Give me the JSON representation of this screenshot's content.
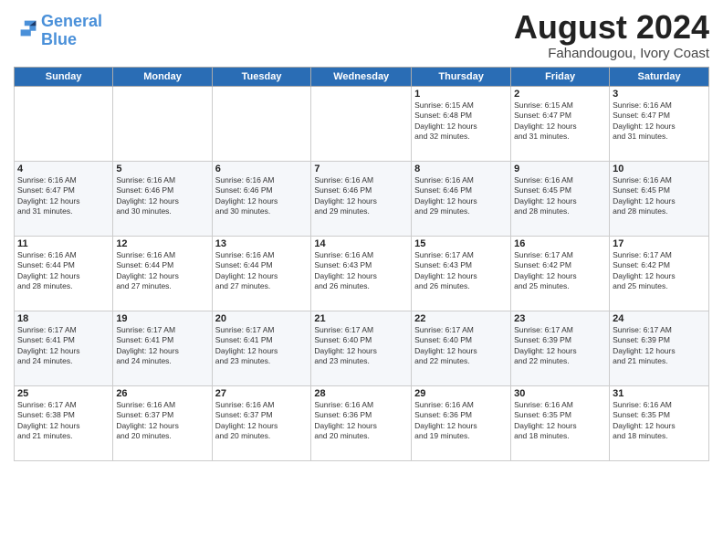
{
  "header": {
    "logo_line1": "General",
    "logo_line2": "Blue",
    "title": "August 2024",
    "subtitle": "Fahandougou, Ivory Coast"
  },
  "calendar": {
    "weekdays": [
      "Sunday",
      "Monday",
      "Tuesday",
      "Wednesday",
      "Thursday",
      "Friday",
      "Saturday"
    ],
    "weeks": [
      [
        {
          "day": "",
          "info": ""
        },
        {
          "day": "",
          "info": ""
        },
        {
          "day": "",
          "info": ""
        },
        {
          "day": "",
          "info": ""
        },
        {
          "day": "1",
          "info": "Sunrise: 6:15 AM\nSunset: 6:48 PM\nDaylight: 12 hours\nand 32 minutes."
        },
        {
          "day": "2",
          "info": "Sunrise: 6:15 AM\nSunset: 6:47 PM\nDaylight: 12 hours\nand 31 minutes."
        },
        {
          "day": "3",
          "info": "Sunrise: 6:16 AM\nSunset: 6:47 PM\nDaylight: 12 hours\nand 31 minutes."
        }
      ],
      [
        {
          "day": "4",
          "info": "Sunrise: 6:16 AM\nSunset: 6:47 PM\nDaylight: 12 hours\nand 31 minutes."
        },
        {
          "day": "5",
          "info": "Sunrise: 6:16 AM\nSunset: 6:46 PM\nDaylight: 12 hours\nand 30 minutes."
        },
        {
          "day": "6",
          "info": "Sunrise: 6:16 AM\nSunset: 6:46 PM\nDaylight: 12 hours\nand 30 minutes."
        },
        {
          "day": "7",
          "info": "Sunrise: 6:16 AM\nSunset: 6:46 PM\nDaylight: 12 hours\nand 29 minutes."
        },
        {
          "day": "8",
          "info": "Sunrise: 6:16 AM\nSunset: 6:46 PM\nDaylight: 12 hours\nand 29 minutes."
        },
        {
          "day": "9",
          "info": "Sunrise: 6:16 AM\nSunset: 6:45 PM\nDaylight: 12 hours\nand 28 minutes."
        },
        {
          "day": "10",
          "info": "Sunrise: 6:16 AM\nSunset: 6:45 PM\nDaylight: 12 hours\nand 28 minutes."
        }
      ],
      [
        {
          "day": "11",
          "info": "Sunrise: 6:16 AM\nSunset: 6:44 PM\nDaylight: 12 hours\nand 28 minutes."
        },
        {
          "day": "12",
          "info": "Sunrise: 6:16 AM\nSunset: 6:44 PM\nDaylight: 12 hours\nand 27 minutes."
        },
        {
          "day": "13",
          "info": "Sunrise: 6:16 AM\nSunset: 6:44 PM\nDaylight: 12 hours\nand 27 minutes."
        },
        {
          "day": "14",
          "info": "Sunrise: 6:16 AM\nSunset: 6:43 PM\nDaylight: 12 hours\nand 26 minutes."
        },
        {
          "day": "15",
          "info": "Sunrise: 6:17 AM\nSunset: 6:43 PM\nDaylight: 12 hours\nand 26 minutes."
        },
        {
          "day": "16",
          "info": "Sunrise: 6:17 AM\nSunset: 6:42 PM\nDaylight: 12 hours\nand 25 minutes."
        },
        {
          "day": "17",
          "info": "Sunrise: 6:17 AM\nSunset: 6:42 PM\nDaylight: 12 hours\nand 25 minutes."
        }
      ],
      [
        {
          "day": "18",
          "info": "Sunrise: 6:17 AM\nSunset: 6:41 PM\nDaylight: 12 hours\nand 24 minutes."
        },
        {
          "day": "19",
          "info": "Sunrise: 6:17 AM\nSunset: 6:41 PM\nDaylight: 12 hours\nand 24 minutes."
        },
        {
          "day": "20",
          "info": "Sunrise: 6:17 AM\nSunset: 6:41 PM\nDaylight: 12 hours\nand 23 minutes."
        },
        {
          "day": "21",
          "info": "Sunrise: 6:17 AM\nSunset: 6:40 PM\nDaylight: 12 hours\nand 23 minutes."
        },
        {
          "day": "22",
          "info": "Sunrise: 6:17 AM\nSunset: 6:40 PM\nDaylight: 12 hours\nand 22 minutes."
        },
        {
          "day": "23",
          "info": "Sunrise: 6:17 AM\nSunset: 6:39 PM\nDaylight: 12 hours\nand 22 minutes."
        },
        {
          "day": "24",
          "info": "Sunrise: 6:17 AM\nSunset: 6:39 PM\nDaylight: 12 hours\nand 21 minutes."
        }
      ],
      [
        {
          "day": "25",
          "info": "Sunrise: 6:17 AM\nSunset: 6:38 PM\nDaylight: 12 hours\nand 21 minutes."
        },
        {
          "day": "26",
          "info": "Sunrise: 6:16 AM\nSunset: 6:37 PM\nDaylight: 12 hours\nand 20 minutes."
        },
        {
          "day": "27",
          "info": "Sunrise: 6:16 AM\nSunset: 6:37 PM\nDaylight: 12 hours\nand 20 minutes."
        },
        {
          "day": "28",
          "info": "Sunrise: 6:16 AM\nSunset: 6:36 PM\nDaylight: 12 hours\nand 20 minutes."
        },
        {
          "day": "29",
          "info": "Sunrise: 6:16 AM\nSunset: 6:36 PM\nDaylight: 12 hours\nand 19 minutes."
        },
        {
          "day": "30",
          "info": "Sunrise: 6:16 AM\nSunset: 6:35 PM\nDaylight: 12 hours\nand 18 minutes."
        },
        {
          "day": "31",
          "info": "Sunrise: 6:16 AM\nSunset: 6:35 PM\nDaylight: 12 hours\nand 18 minutes."
        }
      ]
    ]
  }
}
